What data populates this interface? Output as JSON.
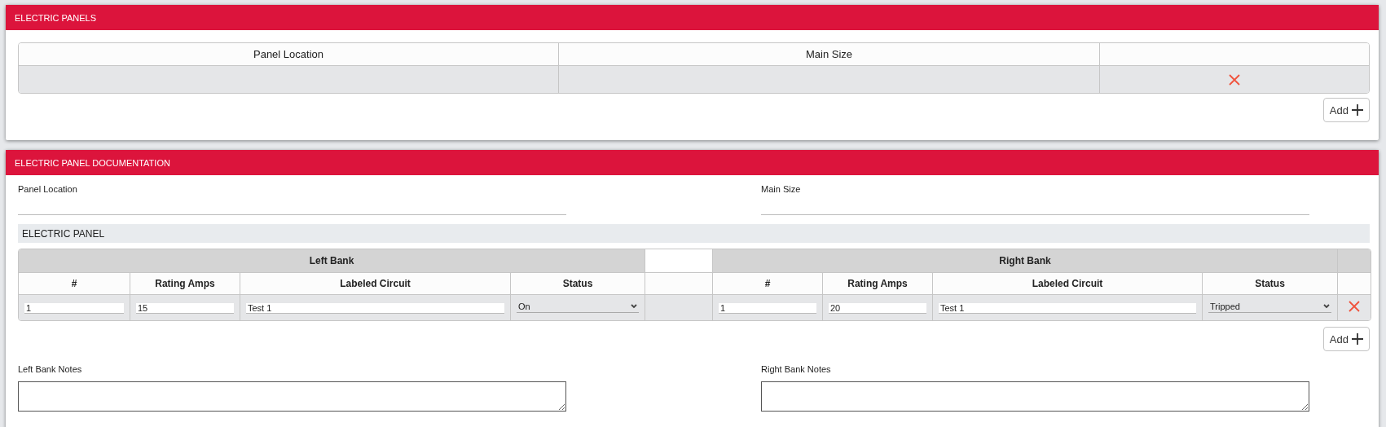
{
  "panels_section": {
    "title": "ELECTRIC PANELS",
    "columns": [
      "Panel Location",
      "Main Size"
    ],
    "rows": [
      {
        "deletable": true
      }
    ],
    "add_button": "Add"
  },
  "documentation": {
    "title": "ELECTRIC PANEL DOCUMENTATION",
    "fields": [
      {
        "label": "Panel Location"
      },
      {
        "label": "Main Size"
      }
    ],
    "subsection": "ELECTRIC PANEL",
    "banks": [
      {
        "title": "Left Bank",
        "columns": [
          "#",
          "Rating Amps",
          "Labeled Circuit",
          "Status"
        ]
      },
      {
        "title": "Right Bank",
        "columns": [
          "#",
          "Rating Amps",
          "Labeled Circuit",
          "Status"
        ]
      }
    ],
    "rows": [
      {
        "left": {
          "number": "1",
          "rating": "15",
          "circuit": "Test 1",
          "status": "On"
        },
        "right": {
          "number": "1",
          "rating": "20",
          "circuit": "Test 1",
          "status": "Tripped"
        },
        "deletable": true
      }
    ],
    "add_button": "Add",
    "notes": [
      {
        "label": "Left Bank Notes"
      },
      {
        "label": "Right Bank Notes"
      }
    ]
  }
}
